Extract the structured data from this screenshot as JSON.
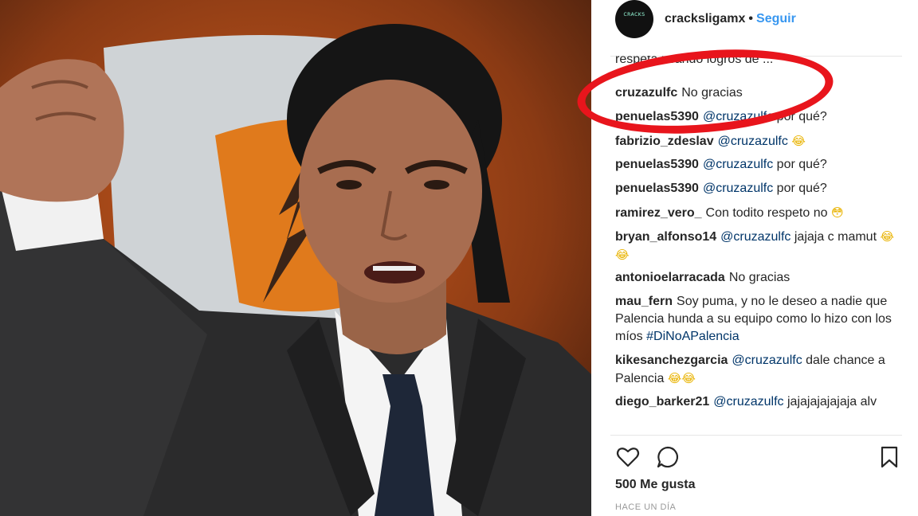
{
  "post": {
    "username": "cracksligamx",
    "dot": "•",
    "follow_label": "Seguir",
    "avatar_text": "CRACKS",
    "cut_text": "respeta usando logros de ...",
    "comments": [
      {
        "user": "cruzazulfc",
        "text": "No gracias"
      },
      {
        "user": "penuelas5390",
        "mention": "@cruzazulfc",
        "text": " por qué?"
      },
      {
        "user": "fabrizio_zdeslav",
        "mention": "@cruzazulfc",
        "text": "",
        "emoji": "😂"
      },
      {
        "user": "penuelas5390",
        "mention": "@cruzazulfc",
        "text": " por qué?"
      },
      {
        "user": "penuelas5390",
        "mention": "@cruzazulfc",
        "text": " por qué?"
      },
      {
        "user": "ramirez_vero_",
        "text": "Con todito respeto no",
        "emoji": "😳"
      },
      {
        "user": "bryan_alfonso14",
        "mention": "@cruzazulfc",
        "text": " jajaja c mamut",
        "emoji": "😂😂"
      },
      {
        "user": "antonioelarracada",
        "text": "No gracias"
      },
      {
        "user": "mau_fern",
        "text": "Soy puma, y no le deseo a nadie que Palencia hunda a su equipo como lo hizo con los míos",
        "hashtag": "#DiNoAPalencia"
      },
      {
        "user": "kikesanchezgarcia",
        "mention": "@cruzazulfc",
        "text": " dale chance a Palencia",
        "emoji": "😂😂"
      },
      {
        "user": "diego_barker21",
        "mention": "@cruzazulfc",
        "text": " jajajajajajaja alv"
      }
    ],
    "likes": "500 Me gusta",
    "time": "HACE UN DÍA"
  },
  "icons": {
    "like": "heart-icon",
    "comment": "comment-bubble-icon",
    "save": "bookmark-icon"
  },
  "colors": {
    "link": "#3897f0",
    "mention": "#003569",
    "highlight_circle": "#e8151c"
  }
}
